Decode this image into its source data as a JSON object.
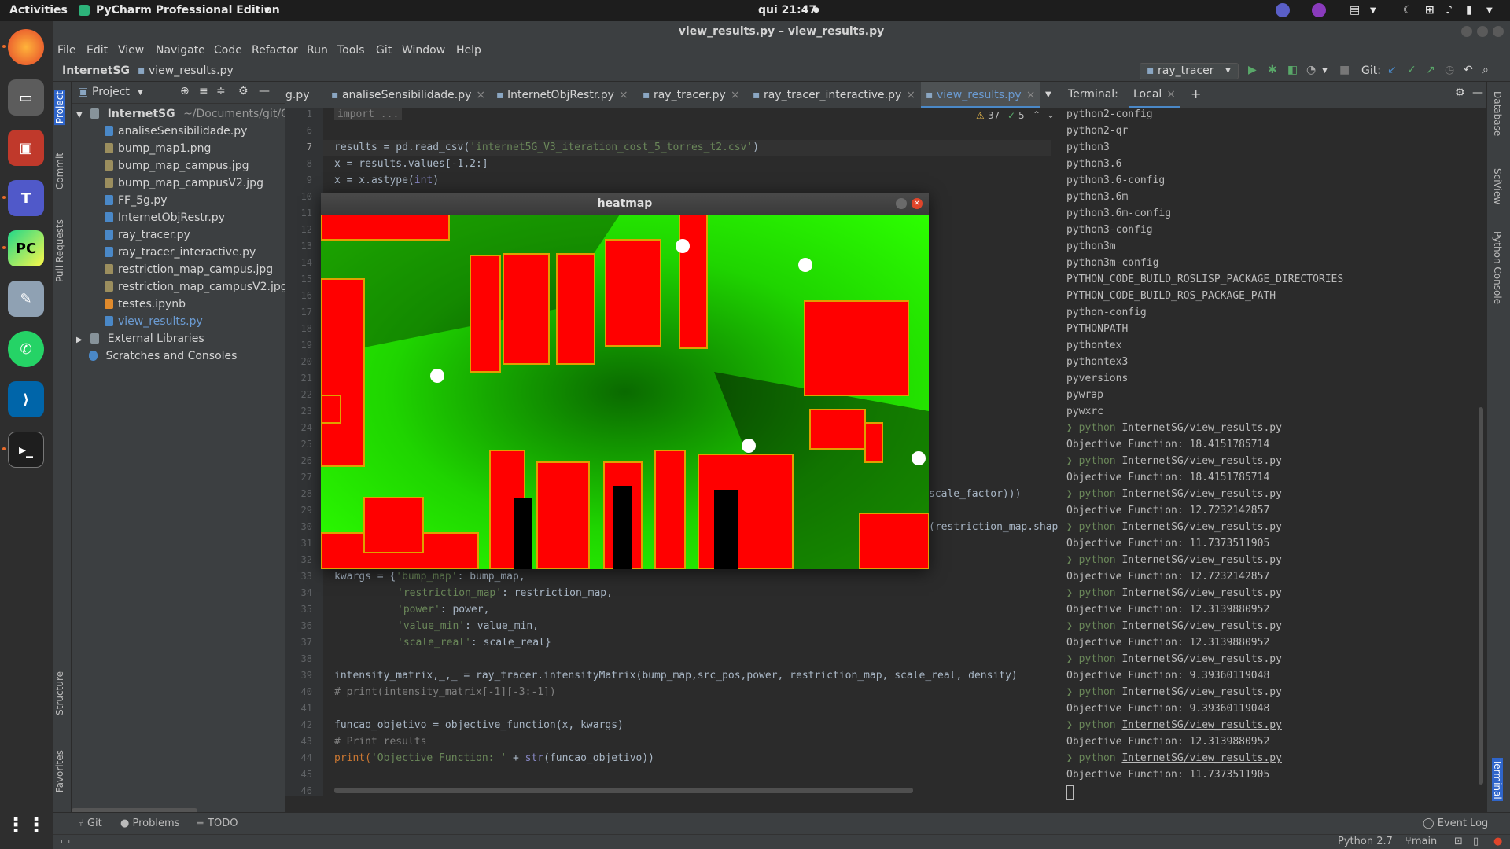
{
  "topbar": {
    "activities": "Activities",
    "app": "PyCharm Professional Edition",
    "clock": "qui 21:47"
  },
  "window": {
    "title": "view_results.py – view_results.py"
  },
  "menu": [
    "File",
    "Edit",
    "View",
    "Navigate",
    "Code",
    "Refactor",
    "Run",
    "Tools",
    "Git",
    "Window",
    "Help"
  ],
  "breadcrumb": {
    "project": "InternetSG",
    "file": "view_results.py"
  },
  "toolbar": {
    "run_config": "ray_tracer",
    "git_label": "Git:"
  },
  "project_panel": {
    "header": "Project",
    "root": "InternetSG",
    "root_path": "~/Documents/git/Ot",
    "files": [
      "analiseSensibilidade.py",
      "bump_map1.png",
      "bump_map_campus.jpg",
      "bump_map_campusV2.jpg",
      "FF_5g.py",
      "InternetObjRestr.py",
      "ray_tracer.py",
      "ray_tracer_interactive.py",
      "restriction_map_campus.jpg",
      "restriction_map_campusV2.jpg",
      "testes.ipynb",
      "view_results.py"
    ],
    "external": "External Libraries",
    "scratches": "Scratches and Consoles"
  },
  "left_strip": [
    "Project",
    "Commit",
    "Pull Requests",
    "Structure",
    "Favorites"
  ],
  "tabs": [
    "g.py",
    "analiseSensibilidade.py",
    "InternetObjRestr.py",
    "ray_tracer.py",
    "ray_tracer_interactive.py",
    "view_results.py"
  ],
  "editor": {
    "warnings": "37",
    "ok": "5",
    "line_numbers": [
      "1",
      "6",
      "7",
      "8",
      "9",
      "10",
      "11",
      "12",
      "13",
      "14",
      "15",
      "16",
      "17",
      "18",
      "19",
      "20",
      "21",
      "22",
      "23",
      "24",
      "25",
      "26",
      "27",
      "28",
      "29",
      "30",
      "31",
      "32",
      "33",
      "34",
      "35",
      "36",
      "37",
      "38",
      "39",
      "40",
      "41",
      "42",
      "43",
      "44",
      "45",
      "46"
    ],
    "lines": {
      "l1": "import ...",
      "l7a": "results = pd.read_csv(",
      "l7b": "'internet5G_V3_iteration_cost_5_torres_t2.csv'",
      "l7c": ")",
      "l8": "x = results.values[-1,2:]",
      "l9a": "x = x.astype(",
      "l9b": "int",
      "l9c": ")",
      "l27": "scale_factor)))",
      "l29": "(restriction_map.shap",
      "l33a": "kwargs = {",
      "l33b": "'bump_map'",
      "l33c": ": bump_map,",
      "l34a": "'restriction_map'",
      "l34b": ": restriction_map,",
      "l35a": "'power'",
      "l35b": ": power,",
      "l36a": "'value_min'",
      "l36b": ": value_min,",
      "l37a": "'scale_real'",
      "l37b": ": scale_real}",
      "l39": "intensity_matrix,_,_ = ray_tracer.intensityMatrix(bump_map,src_pos,power, restriction_map, scale_real, density)",
      "l40": "# print(intensity_matrix[-1][-3:-1])",
      "l42": "funcao_objetivo = objective_function(x, kwargs)",
      "l43": "# Print results",
      "l44a": "print(",
      "l44b": "'Objective Function: '",
      "l44c": " + ",
      "l44d": "str",
      "l44e": "(funcao_objetivo))"
    }
  },
  "heatmap": {
    "title": "heatmap"
  },
  "terminal": {
    "label": "Terminal:",
    "tab": "Local",
    "lines": [
      "python2-config",
      "python2-qr",
      "python3",
      "python3.6",
      "python3.6-config",
      "python3.6m",
      "python3.6m-config",
      "python3-config",
      "python3m",
      "python3m-config",
      "PYTHON_CODE_BUILD_ROSLISP_PACKAGE_DIRECTORIES",
      "PYTHON_CODE_BUILD_ROS_PACKAGE_PATH",
      "python-config",
      "PYTHONPATH",
      "pythontex",
      "pythontex3",
      "pyversions",
      "pywrap",
      "pywxrc"
    ],
    "runs": [
      {
        "cmd": "python",
        "path": "InternetSG/view_results.py",
        "out": "Objective Function: 18.4151785714"
      },
      {
        "cmd": "python",
        "path": "InternetSG/view_results.py",
        "out": "Objective Function: 18.4151785714"
      },
      {
        "cmd": "python",
        "path": "InternetSG/view_results.py",
        "out": "Objective Function: 12.7232142857"
      },
      {
        "cmd": "python",
        "path": "InternetSG/view_results.py",
        "out": "Objective Function: 11.7373511905"
      },
      {
        "cmd": "python",
        "path": "InternetSG/view_results.py",
        "out": "Objective Function: 12.7232142857"
      },
      {
        "cmd": "python",
        "path": "InternetSG/view_results.py",
        "out": "Objective Function: 12.3139880952"
      },
      {
        "cmd": "python",
        "path": "InternetSG/view_results.py",
        "out": "Objective Function: 12.3139880952"
      },
      {
        "cmd": "python",
        "path": "InternetSG/view_results.py",
        "out": "Objective Function: 9.39360119048"
      },
      {
        "cmd": "python",
        "path": "InternetSG/view_results.py",
        "out": "Objective Function: 9.39360119048"
      },
      {
        "cmd": "python",
        "path": "InternetSG/view_results.py",
        "out": "Objective Function: 12.3139880952"
      },
      {
        "cmd": "python",
        "path": "InternetSG/view_results.py",
        "out": "Objective Function: 11.7373511905"
      }
    ]
  },
  "right_strip": [
    "Database",
    "SciView",
    "Python Console",
    "Terminal"
  ],
  "bottom_tools": {
    "git": "Git",
    "problems": "Problems",
    "todo": "TODO",
    "event_log": "Event Log"
  },
  "status": {
    "interpreter": "Python 2.7",
    "branch": "main"
  },
  "colors": {
    "accent": "#4a88c7",
    "heat_green": "#22e000",
    "heat_red": "#ff0000",
    "prompt_green": "#6a8759"
  }
}
